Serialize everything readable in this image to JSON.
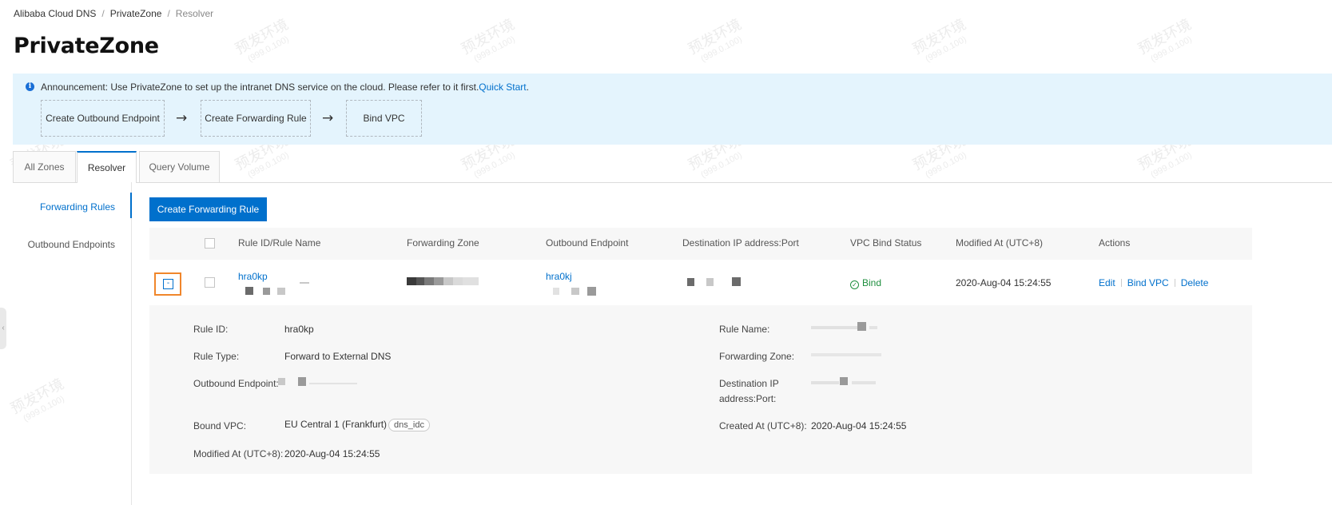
{
  "breadcrumb": [
    "Alibaba Cloud DNS",
    "PrivateZone",
    "Resolver"
  ],
  "page_title": "PrivateZone",
  "watermark": {
    "line1": "预发环境",
    "line2": "(999.0.100)"
  },
  "announcement": {
    "text": "Announcement: Use PrivateZone to set up the intranet DNS service on the cloud. Please refer to it first.",
    "link": "Quick Start",
    "suffix": ".",
    "steps": [
      "Create Outbound Endpoint",
      "Create Forwarding Rule",
      "Bind VPC"
    ],
    "arrow": "→"
  },
  "tabs": [
    {
      "label": "All Zones",
      "active": false
    },
    {
      "label": "Resolver",
      "active": true
    },
    {
      "label": "Query Volume",
      "active": false
    }
  ],
  "subnav": [
    {
      "label": "Forwarding Rules",
      "active": true
    },
    {
      "label": "Outbound Endpoints",
      "active": false
    }
  ],
  "create_button": "Create Forwarding Rule",
  "table": {
    "columns": [
      "Rule ID/Rule Name",
      "Forwarding Zone",
      "Outbound Endpoint",
      "Destination IP address:Port",
      "VPC Bind Status",
      "Modified At (UTC+8)",
      "Actions"
    ],
    "row": {
      "expand_symbol": "-",
      "rule_id": "hra0kp",
      "outbound_endpoint": "hra0kj",
      "status": "Bind",
      "status_icon": "✓",
      "modified_at": "2020-Aug-04 15:24:55",
      "actions": [
        "Edit",
        "Bind VPC",
        "Delete"
      ]
    }
  },
  "detail": {
    "rule_id_label": "Rule ID:",
    "rule_id_value": "hra0kp",
    "rule_type_label": "Rule Type:",
    "rule_type_value": "Forward to External DNS",
    "outbound_label": "Outbound Endpoint:",
    "bound_vpc_label": "Bound VPC:",
    "bound_vpc_value": "EU Central 1 (Frankfurt)",
    "bound_vpc_tag": "dns_idc",
    "modified_label": "Modified At (UTC+8):",
    "modified_value": "2020-Aug-04 15:24:55",
    "rule_name_label": "Rule Name:",
    "forwarding_zone_label": "Forwarding Zone:",
    "dest_ip_label_1": "Destination IP",
    "dest_ip_label_2": "address:Port:",
    "created_label": "Created At (UTC+8):",
    "created_value": "2020-Aug-04 15:24:55"
  }
}
